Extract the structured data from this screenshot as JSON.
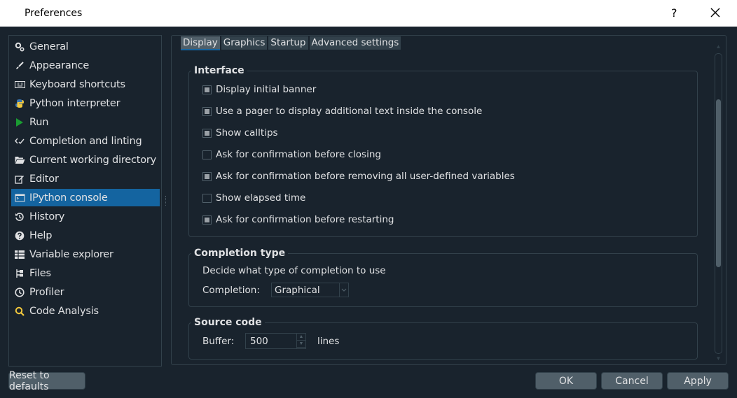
{
  "window": {
    "title": "Preferences",
    "help_label": "?"
  },
  "sidebar": {
    "items": [
      {
        "label": "General",
        "icon": "gears-icon"
      },
      {
        "label": "Appearance",
        "icon": "paintbrush-icon"
      },
      {
        "label": "Keyboard shortcuts",
        "icon": "keyboard-icon"
      },
      {
        "label": "Python interpreter",
        "icon": "python-icon"
      },
      {
        "label": "Run",
        "icon": "play-icon"
      },
      {
        "label": "Completion and linting",
        "icon": "completion-icon"
      },
      {
        "label": "Current working directory",
        "icon": "folder-open-icon"
      },
      {
        "label": "Editor",
        "icon": "edit-icon"
      },
      {
        "label": "IPython console",
        "icon": "terminal-icon"
      },
      {
        "label": "History",
        "icon": "history-icon"
      },
      {
        "label": "Help",
        "icon": "question-circle-icon"
      },
      {
        "label": "Variable explorer",
        "icon": "table-icon"
      },
      {
        "label": "Files",
        "icon": "files-icon"
      },
      {
        "label": "Profiler",
        "icon": "clock-icon"
      },
      {
        "label": "Code Analysis",
        "icon": "code-analysis-icon"
      }
    ],
    "selected": "IPython console"
  },
  "tabs": [
    "Display",
    "Graphics",
    "Startup",
    "Advanced settings"
  ],
  "interface": {
    "title": "Interface",
    "options": [
      {
        "label": "Display initial banner",
        "checked": true
      },
      {
        "label": "Use a pager to display additional text inside the console",
        "checked": true
      },
      {
        "label": "Show calltips",
        "checked": true
      },
      {
        "label": "Ask for confirmation before closing",
        "checked": false
      },
      {
        "label": "Ask for confirmation before removing all user-defined variables",
        "checked": true
      },
      {
        "label": "Show elapsed time",
        "checked": false
      },
      {
        "label": "Ask for confirmation before restarting",
        "checked": true
      }
    ]
  },
  "completion": {
    "title": "Completion type",
    "description": "Decide what type of completion to use",
    "label": "Completion:",
    "value": "Graphical"
  },
  "source": {
    "title": "Source code",
    "buffer_label": "Buffer:",
    "buffer_value": "500",
    "unit": "lines"
  },
  "buttons": {
    "reset": "Reset to defaults",
    "ok": "OK",
    "cancel": "Cancel",
    "apply": "Apply"
  },
  "colors": {
    "accent": "#1464a0",
    "background": "#19232d",
    "border": "#32414b",
    "button": "#505f69"
  }
}
